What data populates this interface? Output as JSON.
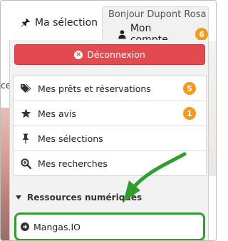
{
  "header": {
    "selection_tab_label": "Ma sélection",
    "greeting": "Bonjour Dupont Rosa",
    "account_label": "Mon compte",
    "account_badge": "6"
  },
  "dropdown": {
    "logout_label": "Déconnexion",
    "items": [
      {
        "label": "Mes prêts et réservations",
        "icon": "tags-icon",
        "badge": "5"
      },
      {
        "label": "Mes avis",
        "icon": "star-icon",
        "badge": "1"
      },
      {
        "label": "Mes sélections",
        "icon": "pin-icon",
        "badge": ""
      },
      {
        "label": "Mes recherches",
        "icon": "search-icon",
        "badge": ""
      }
    ],
    "section_title": "Ressources numériques",
    "resource_label": "Mangas.IO"
  },
  "colors": {
    "logout_bg": "#e34a4f",
    "badge_bg": "#f29a1a",
    "highlight_green": "#2f9e2f"
  },
  "background_fragment_text": "ce"
}
